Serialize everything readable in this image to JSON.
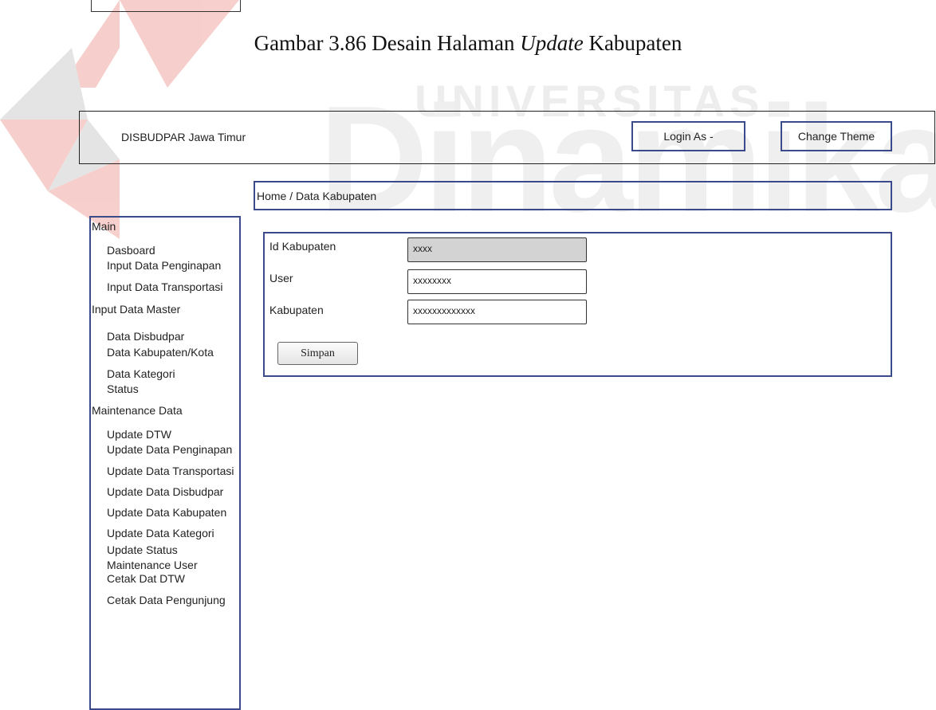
{
  "caption": {
    "prefix": "Gambar 3.86 Desain Halaman ",
    "italic": "Update",
    "suffix": " Kabupaten"
  },
  "watermark": {
    "line1": "UNIVERSITAS",
    "line2": "Dinamika"
  },
  "header": {
    "brand": "DISBUDPAR Jawa Timur",
    "login_label": "Login As -",
    "theme_label": "Change Theme"
  },
  "breadcrumb": "Home / Data Kabupaten",
  "sidebar": {
    "main": "Main",
    "dasboard": "Dasboard",
    "input_penginapan": "Input Data Penginapan",
    "input_transportasi": "Input Data Transportasi",
    "input_master": "Input Data Master",
    "data_disbudpar": "Data Disbudpar",
    "data_kabupaten": "Data Kabupaten/Kota",
    "data_kategori": "Data Kategori",
    "status": "Status",
    "maintenance": "Maintenance Data",
    "update_dtw": "Update DTW",
    "update_penginapan": "Update Data Penginapan",
    "update_transportasi": "Update Data Transportasi",
    "update_disbudpar": "Update Data Disbudpar",
    "update_kabupaten": "Update Data Kabupaten",
    "update_kategori": "Update Data Kategori",
    "update_status": "Update Status",
    "maintenance_user": "Maintenance User",
    "cetak_dtw": "Cetak Dat DTW",
    "cetak_pengunjung": "Cetak Data Pengunjung"
  },
  "form": {
    "id_label": "Id Kabupaten",
    "id_value": "xxxx",
    "user_label": "User",
    "user_value": "xxxxxxxx",
    "kabupaten_label": "Kabupaten",
    "kabupaten_value": "xxxxxxxxxxxxx",
    "save_label": "Simpan"
  },
  "colors": {
    "frame_border": "#3a4a8a",
    "readonly_bg": "#d3d3d3",
    "watermark_red": "#d9291c"
  }
}
